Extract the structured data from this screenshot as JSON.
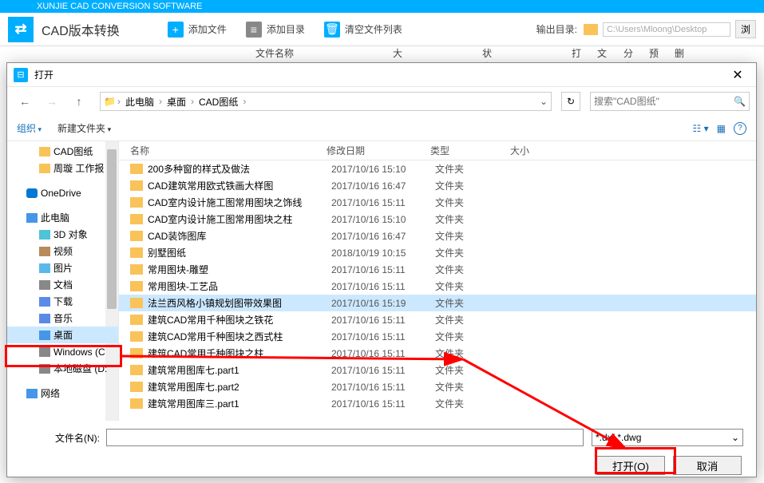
{
  "app": {
    "brand": "XUNJIE CAD CONVERSION SOFTWARE",
    "title": "CAD版本转换",
    "addFile": "添加文件",
    "addDir": "添加目录",
    "clearList": "清空文件列表",
    "outLabel": "输出目录:",
    "outPath": "C:\\Users\\Mloong\\Desktop",
    "browse": "浏",
    "headers": {
      "name": "文件名称",
      "size": "大小",
      "status": "状态",
      "open": "打开",
      "folder": "文件夹",
      "share": "分享",
      "preview": "预览",
      "del": "删"
    }
  },
  "dialog": {
    "title": "打开",
    "breadcrumb": [
      "此电脑",
      "桌面",
      "CAD图纸"
    ],
    "searchPlaceholder": "搜索\"CAD图纸\"",
    "organize": "组织",
    "newFolder": "新建文件夹",
    "cols": {
      "name": "名称",
      "date": "修改日期",
      "type": "类型",
      "size": "大小"
    },
    "filenameLabel": "文件名(N):",
    "fileType": "*.dxf *.dwg",
    "openBtn": "打开(O)",
    "cancelBtn": "取消"
  },
  "sidebar": [
    {
      "label": "CAD图纸",
      "icon": "folder",
      "indent": true
    },
    {
      "label": "周璇 工作报",
      "icon": "folder",
      "indent": true
    },
    {
      "label": "OneDrive",
      "icon": "onedrive",
      "indent": false,
      "gap": true
    },
    {
      "label": "此电脑",
      "icon": "pc",
      "indent": false,
      "gap": true
    },
    {
      "label": "3D 对象",
      "icon": "cube",
      "indent": true
    },
    {
      "label": "视频",
      "icon": "film",
      "indent": true
    },
    {
      "label": "图片",
      "icon": "pic",
      "indent": true
    },
    {
      "label": "文档",
      "icon": "doc",
      "indent": true
    },
    {
      "label": "下载",
      "icon": "dl",
      "indent": true
    },
    {
      "label": "音乐",
      "icon": "music",
      "indent": true
    },
    {
      "label": "桌面",
      "icon": "desktop",
      "indent": true,
      "selected": true
    },
    {
      "label": "Windows (C",
      "icon": "disk",
      "indent": true
    },
    {
      "label": "本地磁盘 (D:",
      "icon": "disk",
      "indent": true
    },
    {
      "label": "网络",
      "icon": "net",
      "indent": false,
      "gap": true
    }
  ],
  "files": [
    {
      "name": "200多种窗的样式及做法",
      "date": "2017/10/16 15:10",
      "type": "文件夹"
    },
    {
      "name": "CAD建筑常用欧式铁画大样图",
      "date": "2017/10/16 16:47",
      "type": "文件夹"
    },
    {
      "name": "CAD室内设计施工图常用图块之饰线",
      "date": "2017/10/16 15:11",
      "type": "文件夹"
    },
    {
      "name": "CAD室内设计施工图常用图块之柱",
      "date": "2017/10/16 15:10",
      "type": "文件夹"
    },
    {
      "name": "CAD装饰图库",
      "date": "2017/10/16 16:47",
      "type": "文件夹"
    },
    {
      "name": "别墅图纸",
      "date": "2018/10/19 10:15",
      "type": "文件夹"
    },
    {
      "name": "常用图块-雕塑",
      "date": "2017/10/16 15:11",
      "type": "文件夹"
    },
    {
      "name": "常用图块-工艺品",
      "date": "2017/10/16 15:11",
      "type": "文件夹"
    },
    {
      "name": "法兰西风格小镇规划图带效果图",
      "date": "2017/10/16 15:19",
      "type": "文件夹",
      "selected": true
    },
    {
      "name": "建筑CAD常用千种图块之铁花",
      "date": "2017/10/16 15:11",
      "type": "文件夹"
    },
    {
      "name": "建筑CAD常用千种图块之西式柱",
      "date": "2017/10/16 15:11",
      "type": "文件夹"
    },
    {
      "name": "建筑CAD常用千种图块之柱",
      "date": "2017/10/16 15:11",
      "type": "文件夹"
    },
    {
      "name": "建筑常用图库七.part1",
      "date": "2017/10/16 15:11",
      "type": "文件夹"
    },
    {
      "name": "建筑常用图库七.part2",
      "date": "2017/10/16 15:11",
      "type": "文件夹"
    },
    {
      "name": "建筑常用图库三.part1",
      "date": "2017/10/16 15:11",
      "type": "文件夹"
    }
  ]
}
